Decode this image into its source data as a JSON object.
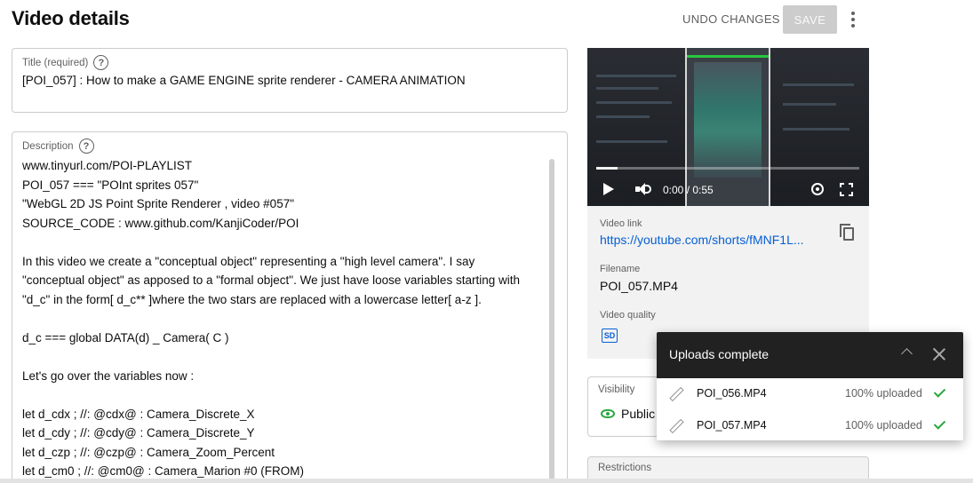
{
  "header": {
    "title": "Video details",
    "undo_label": "UNDO CHANGES",
    "save_label": "SAVE",
    "more_icon": "more-vert-icon"
  },
  "title_field": {
    "label": "Title (required)",
    "help": "?",
    "value": "[POI_057] : How to make a GAME ENGINE sprite renderer - CAMERA ANIMATION"
  },
  "description_field": {
    "label": "Description",
    "help": "?",
    "lines": [
      "www.tinyurl.com/POI-PLAYLIST",
      "POI_057 === \"POInt sprites 057\"",
      "\"WebGL 2D JS Point Sprite Renderer , video #057\"",
      "SOURCE_CODE : www.github.com/KanjiCoder/POI",
      "",
      "In this video we create a \"conceptual object\" representing a \"high level camera\". I say",
      "\"conceptual object\" as apposed to a \"formal object\". We just have loose variables starting with",
      "\"d_c\" in the form[ d_c** ]where the two stars are replaced with a lowercase letter[ a-z ].",
      "",
      "d_c === global DATA(d) _ Camera( C )",
      "",
      "Let's go over the variables now :",
      "",
      "let d_cdx ; //: @cdx@ : Camera_Discrete_X",
      "let d_cdy ; //: @cdy@ : Camera_Discrete_Y",
      "let d_czp ; //: @czp@ : Camera_Zoom_Percent",
      "let d_cm0 ; //: @cm0@ : Camera_Marion #0 (FROM)"
    ]
  },
  "video_panel": {
    "time": "0:00 / 0:55",
    "progress": 0.0,
    "video_link_label": "Video link",
    "video_link": "https://youtube.com/shorts/fMNF1L...",
    "filename_label": "Filename",
    "filename": "POI_057.MP4",
    "quality_label": "Video quality",
    "quality_badge": "SD"
  },
  "visibility": {
    "label": "Visibility",
    "value": "Public"
  },
  "restrictions": {
    "label": "Restrictions"
  },
  "upload_toast": {
    "title": "Uploads complete",
    "items": [
      {
        "file": "POI_056.MP4",
        "status": "100% uploaded"
      },
      {
        "file": "POI_057.MP4",
        "status": "100% uploaded"
      }
    ]
  },
  "colors": {
    "accent_link": "#065fd4",
    "success": "#2ba640",
    "toast_header": "#212121"
  }
}
